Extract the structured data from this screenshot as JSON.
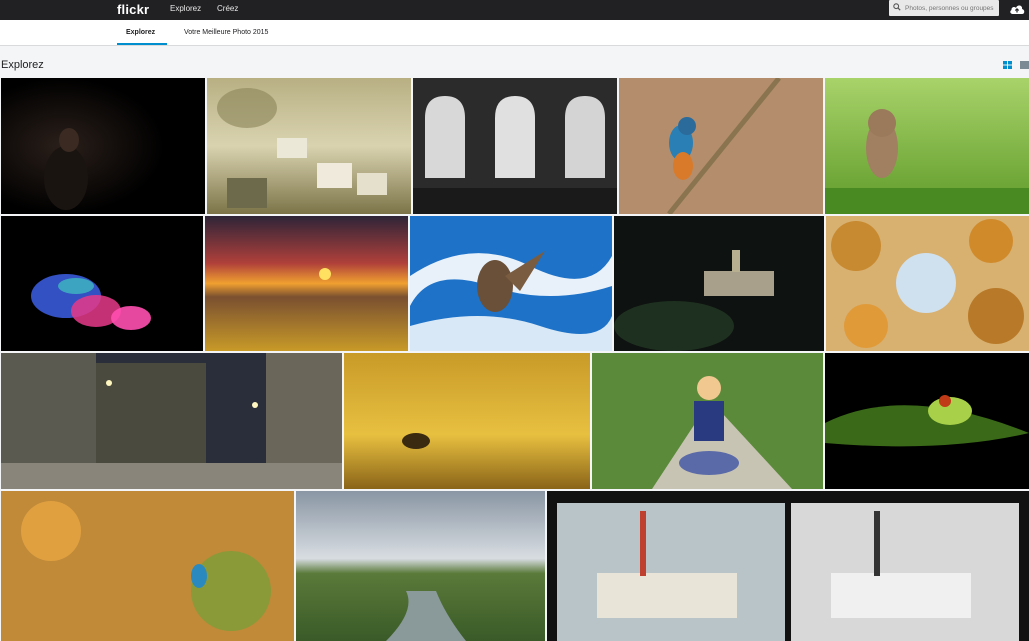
{
  "topbar": {
    "logo": "flickr",
    "nav": [
      "Explorez",
      "Créez"
    ],
    "search_placeholder": "Photos, personnes ou groupes",
    "icons": {
      "search": "search-icon",
      "upload": "cloud-upload-icon"
    }
  },
  "subnav": {
    "tabs": [
      "Explorez",
      "Votre Meilleure Photo 2015"
    ],
    "active_tab": "Explorez"
  },
  "page": {
    "title": "Explorez",
    "view_options": [
      "grid-view-icon",
      "single-view-icon"
    ]
  },
  "colors": {
    "topbar": "#212124",
    "accent": "#008ecf",
    "background": "#f3f5f6"
  },
  "photos_count": 18
}
